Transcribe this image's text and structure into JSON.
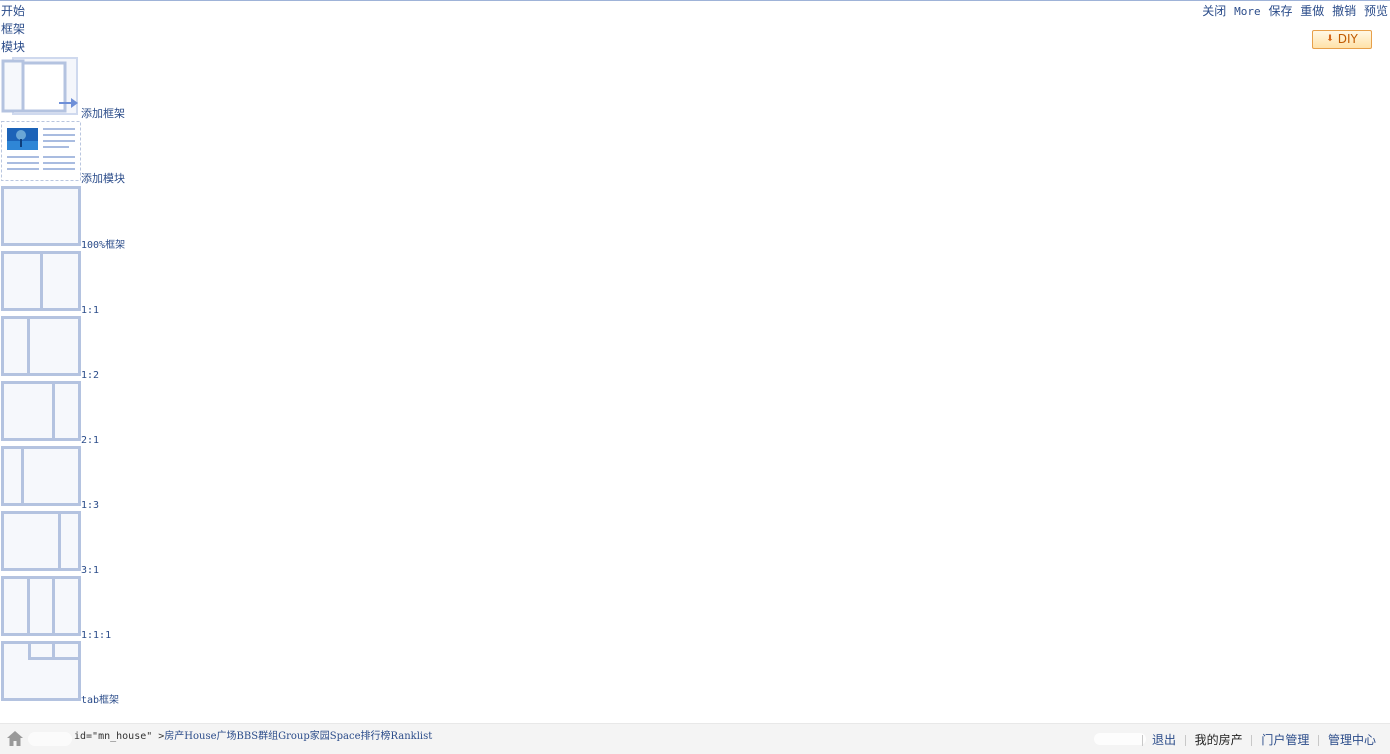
{
  "tabs": [
    "开始",
    "框架",
    "模块"
  ],
  "toolbar": {
    "close": "关闭",
    "more": "More",
    "save": "保存",
    "redo": "重做",
    "undo": "撤销",
    "preview": "预览"
  },
  "diy_button": {
    "label": "DIY",
    "icon": "down-arrow-icon"
  },
  "palette": [
    {
      "label": "添加框架"
    },
    {
      "label": "添加模块"
    },
    {
      "label": "100%框架"
    },
    {
      "label": "1:1"
    },
    {
      "label": "1:2"
    },
    {
      "label": "2:1"
    },
    {
      "label": "1:3"
    },
    {
      "label": "3:1"
    },
    {
      "label": "1:1:1"
    },
    {
      "label": "tab框架"
    }
  ],
  "footer": {
    "home_icon": "home-icon",
    "code_text": "id=\"mn_house\" >",
    "nav_links": [
      "房产House",
      "广场BBS",
      "群组Group",
      "家园Space",
      "排行榜Ranklist"
    ],
    "links": [
      "退出",
      "我的房产",
      "门户管理",
      "管理中心"
    ]
  },
  "colors": {
    "link": "#2b4c8a",
    "frame_border": "#b4c3e0",
    "frame_fill": "#f6f8fc",
    "diy_border": "#e7a04a"
  }
}
